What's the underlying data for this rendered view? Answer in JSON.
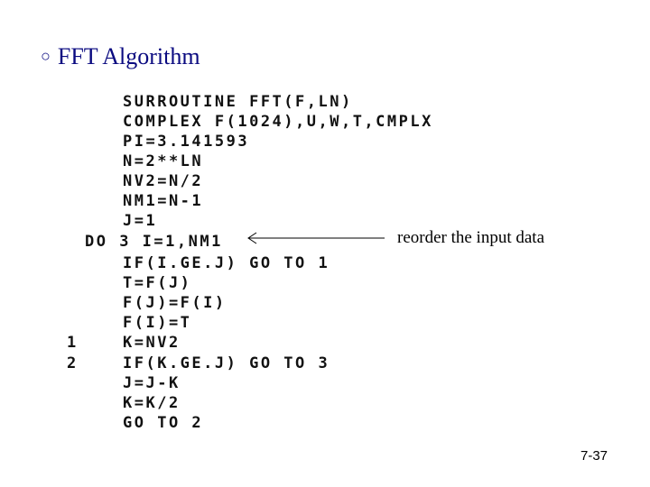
{
  "slide": {
    "title": "FFT Algorithm",
    "bullet": "○",
    "page_number": "7-37"
  },
  "code": {
    "lines": [
      {
        "label": "",
        "text": "SURROUTINE FFT(F,LN)"
      },
      {
        "label": "",
        "text": "COMPLEX F(1024),U,W,T,CMPLX"
      },
      {
        "label": "",
        "text": "PI=3.141593"
      },
      {
        "label": "",
        "text": "N=2**LN"
      },
      {
        "label": "",
        "text": "NV2=N/2"
      },
      {
        "label": "",
        "text": "NM1=N-1"
      },
      {
        "label": "",
        "text": "J=1"
      },
      {
        "label": "",
        "text": "DO 3 I=1,NM1"
      },
      {
        "label": "",
        "text": "IF(I.GE.J) GO TO 1"
      },
      {
        "label": "",
        "text": "T=F(J)"
      },
      {
        "label": "",
        "text": "F(J)=F(I)"
      },
      {
        "label": "",
        "text": "F(I)=T"
      },
      {
        "label": "1",
        "text": "K=NV2"
      },
      {
        "label": "2",
        "text": "IF(K.GE.J) GO TO 3"
      },
      {
        "label": "",
        "text": "J=J-K"
      },
      {
        "label": "",
        "text": "K=K/2"
      },
      {
        "label": "",
        "text": "GO TO 2"
      }
    ]
  },
  "annotation": {
    "text": "reorder the input data",
    "arrow_icon": "left-arrow"
  }
}
